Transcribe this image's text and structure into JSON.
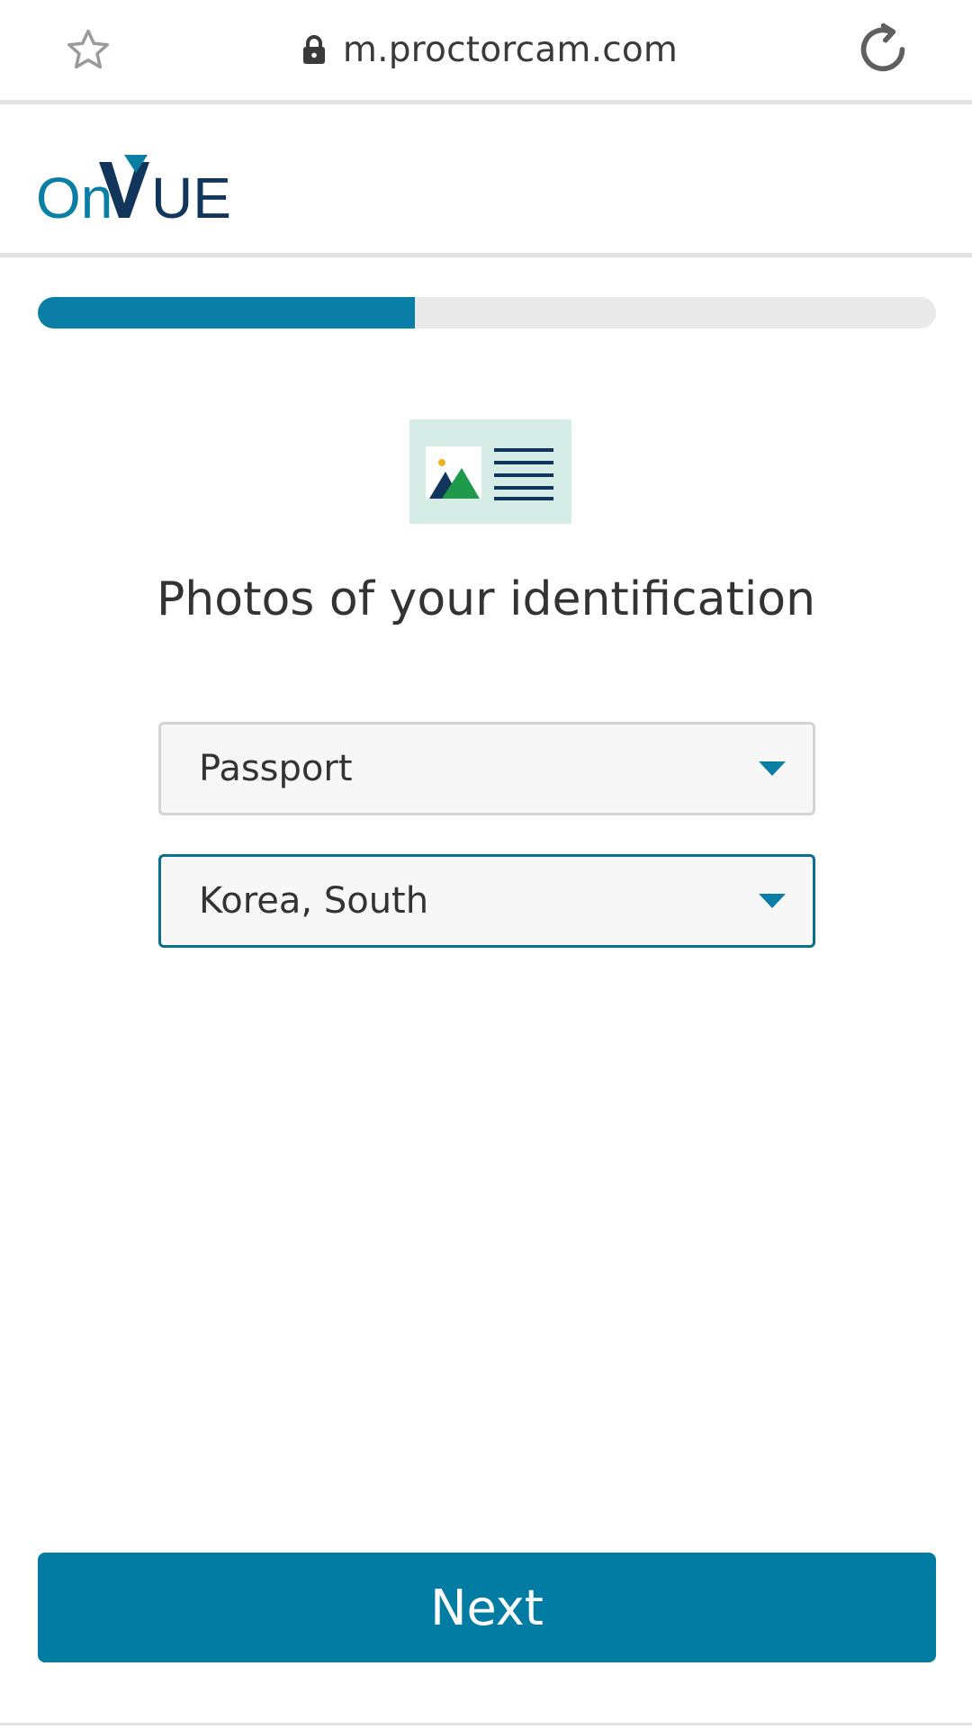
{
  "browser": {
    "url": "m.proctorcam.com",
    "icons": {
      "bookmark": "star-icon",
      "secure": "lock-icon",
      "reload": "reload-icon"
    }
  },
  "header": {
    "logo_text": "OnVUE"
  },
  "progress": {
    "fraction": 0.42
  },
  "main": {
    "illustration": "id-card-icon",
    "title": "Photos of your identification",
    "id_type_select": {
      "value": "Passport"
    },
    "country_select": {
      "value": "Korea, South"
    },
    "next_label": "Next"
  },
  "colors": {
    "accent": "#037ca3",
    "logo_dark": "#12355b",
    "logo_teal": "#0a7ea4"
  }
}
